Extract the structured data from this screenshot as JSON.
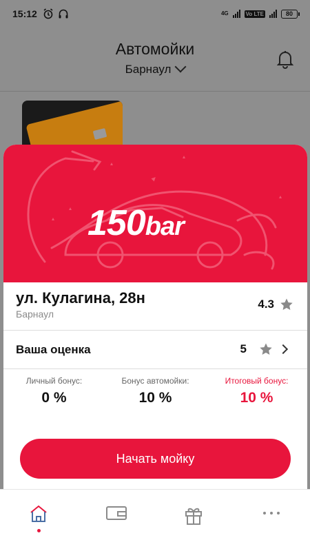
{
  "status_bar": {
    "time": "15:12",
    "net_tag": "4G",
    "volte": "Vo LTE",
    "battery": "80"
  },
  "header": {
    "title": "Автомойки",
    "city": "Барнаул"
  },
  "car_wash": {
    "brand_number": "150",
    "brand_suffix": "bar",
    "address": "ул. Кулагина, 28н",
    "city": "Барнаул",
    "rating": "4.3"
  },
  "my_rating": {
    "label": "Ваша оценка",
    "value": "5"
  },
  "bonuses": {
    "personal_label": "Личный бонус:",
    "personal_value": "0 %",
    "wash_label": "Бонус автомойки:",
    "wash_value": "10 %",
    "total_label": "Итоговый бонус:",
    "total_value": "10 %"
  },
  "start_button": "Начать мойку",
  "nav": {
    "items": [
      "home-icon",
      "wallet-icon",
      "gift-icon",
      "more-icon"
    ],
    "active": "home-icon"
  },
  "colors": {
    "accent": "#e8153c",
    "overlay": "#8e8e8e"
  }
}
